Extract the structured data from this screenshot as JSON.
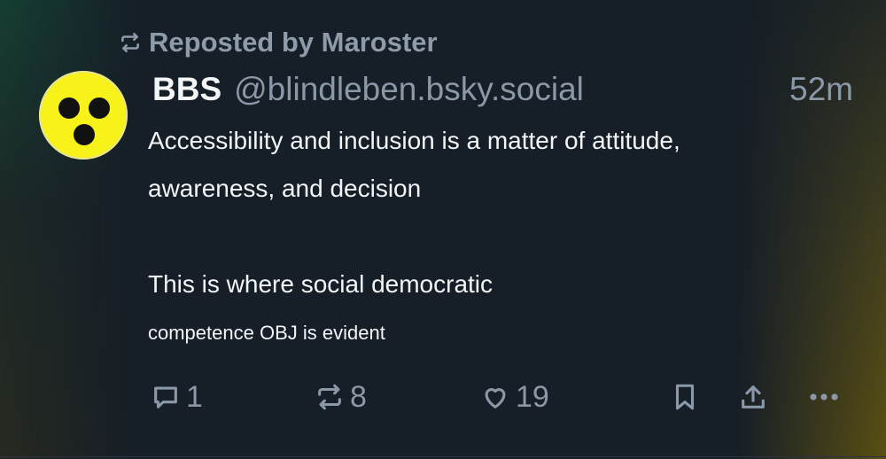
{
  "repost": {
    "text": "Reposted by Maroster",
    "icon": "repost-icon"
  },
  "post": {
    "author_name": "BBS",
    "author_handle": "@blindleben.bsky.social",
    "time": "52m",
    "lines": [
      "Accessibility and inclusion is a matter of attitude,",
      "awareness, and decision",
      "This is where social democratic",
      "competence OBJ is evident"
    ]
  },
  "actions": {
    "reply_count": "1",
    "repost_count": "8",
    "like_count": "19"
  },
  "colors": {
    "background": "#161e27",
    "muted": "#8a98a8",
    "text": "#f3f5f7",
    "avatar": "#f7f21a"
  }
}
